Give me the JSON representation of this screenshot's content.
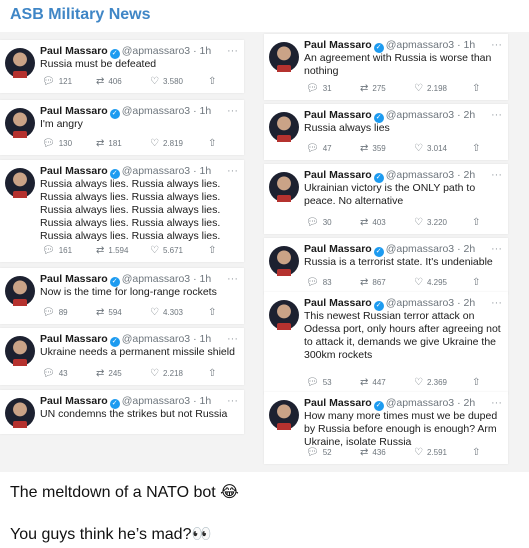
{
  "channel": {
    "name": "ASB Military News"
  },
  "icons": {
    "reply": "reply-icon",
    "retweet": "retweet-icon",
    "like": "heart-icon",
    "share": "share-icon",
    "more": "more-icon"
  },
  "colors": {
    "channel_name": "#3f86c6",
    "verified": "#1d9bf0"
  },
  "tweets": [
    {
      "name": "Paul Massaro",
      "handle": "@apmassaro3",
      "time": "1h",
      "text": "Russia must be defeated",
      "replies": "121",
      "retweets": "406",
      "likes": "3.580"
    },
    {
      "name": "Paul Massaro",
      "handle": "@apmassaro3",
      "time": "1h",
      "text": "I'm angry",
      "replies": "130",
      "retweets": "181",
      "likes": "2.819"
    },
    {
      "name": "Paul Massaro",
      "handle": "@apmassaro3",
      "time": "1h",
      "text": "Russia always lies. Russia always lies. Russia always lies. Russia always lies. Russia always lies. Russia always lies. Russia always lies. Russia always lies. Russia always lies. Russia always lies.",
      "replies": "161",
      "retweets": "1.594",
      "likes": "5.671"
    },
    {
      "name": "Paul Massaro",
      "handle": "@apmassaro3",
      "time": "1h",
      "text": "Now is the time for long-range rockets",
      "replies": "89",
      "retweets": "594",
      "likes": "4.303"
    },
    {
      "name": "Paul Massaro",
      "handle": "@apmassaro3",
      "time": "1h",
      "text": "Ukraine needs a permanent missile shield",
      "replies": "43",
      "retweets": "245",
      "likes": "2.218"
    },
    {
      "name": "Paul Massaro",
      "handle": "@apmassaro3",
      "time": "1h",
      "text": "UN condemns the strikes but not Russia",
      "replies": "",
      "retweets": "",
      "likes": ""
    },
    {
      "name": "Paul Massaro",
      "handle": "@apmassaro3",
      "time": "1h",
      "text": "An agreement with Russia is worse than nothing",
      "replies": "31",
      "retweets": "275",
      "likes": "2.198"
    },
    {
      "name": "Paul Massaro",
      "handle": "@apmassaro3",
      "time": "2h",
      "text": "Russia always lies",
      "replies": "47",
      "retweets": "359",
      "likes": "3.014"
    },
    {
      "name": "Paul Massaro",
      "handle": "@apmassaro3",
      "time": "2h",
      "text": "Ukrainian victory is the ONLY path to peace. No alternative",
      "replies": "30",
      "retweets": "403",
      "likes": "3.220"
    },
    {
      "name": "Paul Massaro",
      "handle": "@apmassaro3",
      "time": "2h",
      "text": "Russia is a terrorist state. It's undeniable",
      "replies": "83",
      "retweets": "867",
      "likes": "4.295"
    },
    {
      "name": "Paul Massaro",
      "handle": "@apmassaro3",
      "time": "2h",
      "text": "This newest Russian terror attack on Odessa port, only hours after agreeing not to attack it, demands we give Ukraine the 300km rockets",
      "replies": "53",
      "retweets": "447",
      "likes": "2.369"
    },
    {
      "name": "Paul Massaro",
      "handle": "@apmassaro3",
      "time": "2h",
      "text": "How many more times must we be duped by Russia before enough is enough? Arm Ukraine, isolate Russia",
      "replies": "52",
      "retweets": "436",
      "likes": "2.591"
    }
  ],
  "captions": [
    "The meltdown of a NATO bot 😂",
    "You guys think he’s mad?👀"
  ]
}
